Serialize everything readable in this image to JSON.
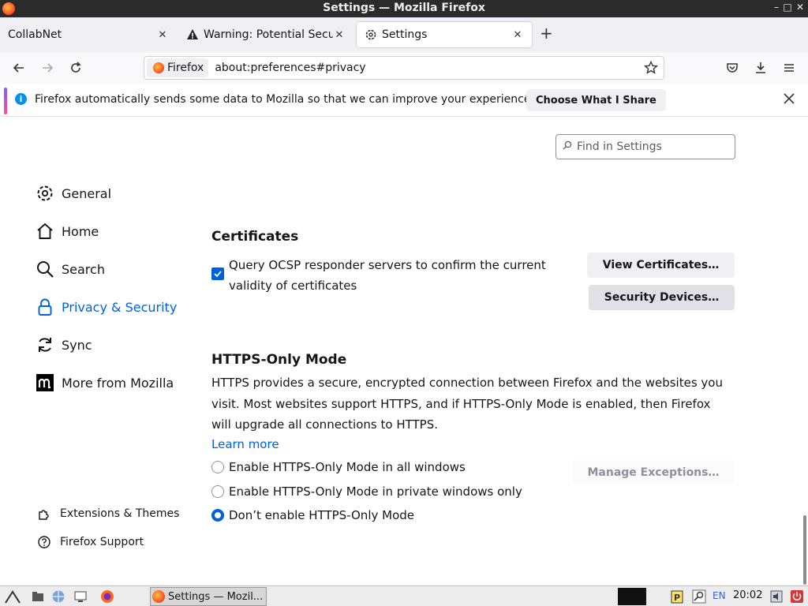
{
  "window": {
    "title": "Settings — Mozilla Firefox"
  },
  "tabs": [
    {
      "label": "CollabNet",
      "icon": "none"
    },
    {
      "label": "Warning: Potential Securi",
      "icon": "warning-icon"
    },
    {
      "label": "Settings",
      "icon": "gear-icon"
    }
  ],
  "urlbar": {
    "identity_label": "Firefox",
    "url": "about:preferences#privacy"
  },
  "notification": {
    "message": "Firefox automatically sends some data to Mozilla so that we can improve your experience.",
    "button": "Choose What I Share"
  },
  "search": {
    "placeholder": "Find in Settings"
  },
  "sidebar": {
    "items": [
      {
        "label": "General",
        "icon": "gear-icon"
      },
      {
        "label": "Home",
        "icon": "home-icon"
      },
      {
        "label": "Search",
        "icon": "search-icon"
      },
      {
        "label": "Privacy & Security",
        "icon": "lock-icon",
        "selected": true
      },
      {
        "label": "Sync",
        "icon": "sync-icon"
      },
      {
        "label": "More from Mozilla",
        "icon": "mozilla-m-icon"
      }
    ],
    "footer": [
      {
        "label": "Extensions & Themes",
        "icon": "puzzle-icon"
      },
      {
        "label": "Firefox Support",
        "icon": "help-icon"
      }
    ]
  },
  "certificates": {
    "title": "Certificates",
    "ocsp_label": "Query OCSP responder servers to confirm the current validity of certificates",
    "ocsp_checked": true,
    "view_button": "View Certificates…",
    "devices_button": "Security Devices…"
  },
  "https_only": {
    "title": "HTTPS-Only Mode",
    "description": "HTTPS provides a secure, encrypted connection between Firefox and the websites you visit. Most websites support HTTPS, and if HTTPS-Only Mode is enabled, then Firefox will upgrade all connections to HTTPS.",
    "learn_more": "Learn more",
    "options": [
      {
        "label": "Enable HTTPS-Only Mode in all windows",
        "selected": false
      },
      {
        "label": "Enable HTTPS-Only Mode in private windows only",
        "selected": false
      },
      {
        "label": "Don’t enable HTTPS-Only Mode",
        "selected": true
      }
    ],
    "exceptions_button": "Manage Exceptions…"
  },
  "taskbar": {
    "task_label": "Settings — Mozil...",
    "language": "EN",
    "clock": "20:02"
  },
  "colors": {
    "accent": "#0061e0",
    "titlebar": "#2b2b2b"
  }
}
